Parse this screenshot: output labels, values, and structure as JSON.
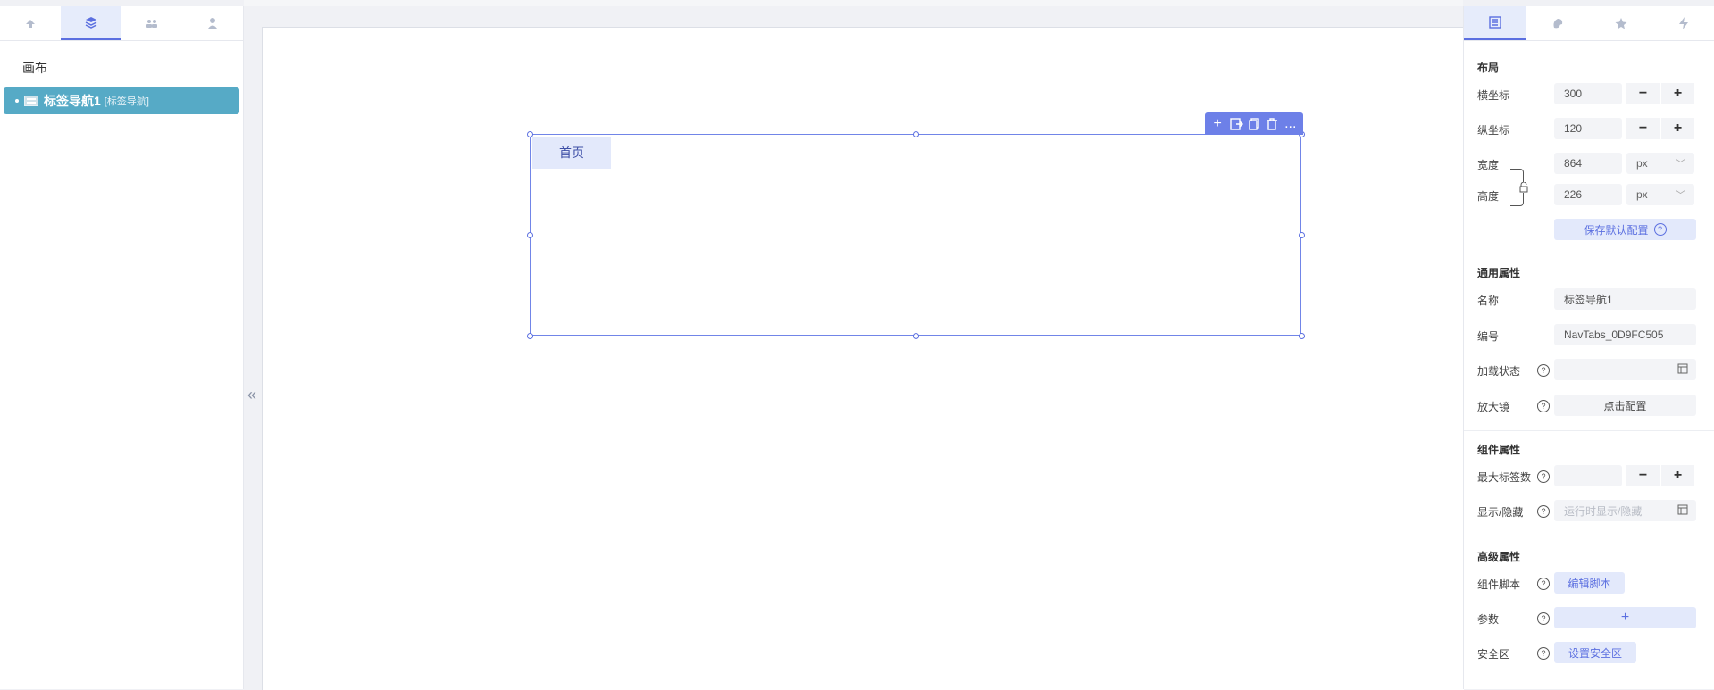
{
  "left_panel": {
    "tabs": [
      {
        "icon": "component-icon"
      },
      {
        "icon": "layers-icon",
        "active": true
      },
      {
        "icon": "users-icon"
      },
      {
        "icon": "user-icon"
      }
    ],
    "canvas_label": "画布",
    "tree": {
      "name": "标签导航1",
      "type": "[标签导航]"
    }
  },
  "canvas": {
    "component": {
      "tab_label": "首页"
    },
    "toolbar": {
      "add": "+",
      "more": "..."
    }
  },
  "right_panel": {
    "tabs": [
      {
        "icon": "properties-icon",
        "active": true
      },
      {
        "icon": "style-icon"
      },
      {
        "icon": "star-icon"
      },
      {
        "icon": "event-icon"
      }
    ],
    "layout": {
      "title": "布局",
      "x_label": "横坐标",
      "x_value": "300",
      "y_label": "纵坐标",
      "y_value": "120",
      "width_label": "宽度",
      "width_value": "864",
      "width_unit": "px",
      "height_label": "高度",
      "height_value": "226",
      "height_unit": "px",
      "save_default": "保存默认配置",
      "minus": "−",
      "plus": "+"
    },
    "common": {
      "title": "通用属性",
      "name_label": "名称",
      "name_value": "标签导航1",
      "id_label": "编号",
      "id_value": "NavTabs_0D9FC505",
      "load_state_label": "加载状态",
      "magnifier_label": "放大镜",
      "magnifier_button": "点击配置"
    },
    "component_props": {
      "title": "组件属性",
      "max_tabs_label": "最大标签数",
      "show_hide_label": "显示/隐藏",
      "show_hide_placeholder": "运行时显示/隐藏"
    },
    "advanced": {
      "title": "高级属性",
      "script_label": "组件脚本",
      "script_button": "编辑脚本",
      "params_label": "参数",
      "params_button": "+",
      "safe_area_label": "安全区",
      "safe_area_button": "设置安全区"
    },
    "help_glyph": "?"
  },
  "colors": {
    "accent": "#5b6fe0",
    "tree_selected": "#56aac6",
    "tab_active_bg": "#e3e9fb"
  }
}
